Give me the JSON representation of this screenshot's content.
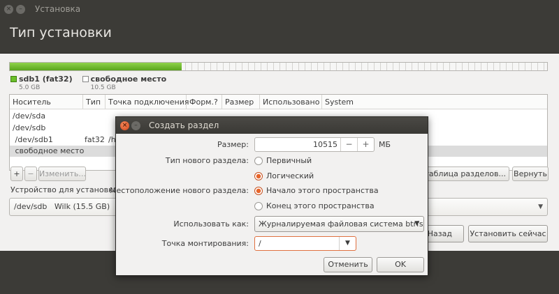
{
  "window": {
    "title": "Установка",
    "close_glyph": "×",
    "min_glyph": "–"
  },
  "heading": "Тип установки",
  "usage": {
    "fill_fraction": 0.32,
    "fill_color": "#6cbf2a"
  },
  "legend": [
    {
      "name": "sdb1 (fat32)",
      "size": "5.0 GB",
      "color": "#6cbf2a"
    },
    {
      "name": "свободное место",
      "size": "10.5 GB",
      "color": "#ffffff"
    }
  ],
  "table": {
    "columns": [
      "Носитель",
      "Тип",
      "Точка подключения",
      "Форм.?",
      "Размер",
      "Использовано",
      "System"
    ],
    "rows": [
      {
        "device": "/dev/sda",
        "type": "",
        "mount": ""
      },
      {
        "device": "/dev/sdb",
        "type": "",
        "mount": ""
      },
      {
        "device": " /dev/sdb1",
        "type": "fat32",
        "mount": "/h"
      },
      {
        "device": " свободное место",
        "type": "",
        "mount": ""
      }
    ]
  },
  "toolbar": {
    "add": "+",
    "remove": "−",
    "change": "Изменить...",
    "new_table": "таблица разделов...",
    "revert": "Вернуть"
  },
  "boot": {
    "label": "Устройство для установки с",
    "value": "/dev/sdb   Wilk (15.5 GB)",
    "arrow": "▼"
  },
  "footer": {
    "back": "Назад",
    "install": "Установить сейчас"
  },
  "dialog": {
    "title": "Создать раздел",
    "size_label": "Размер:",
    "size_value": "10515",
    "minus": "−",
    "plus": "+",
    "unit": "МБ",
    "type_label": "Тип нового раздела:",
    "type_options": [
      "Первичный",
      "Логический"
    ],
    "type_selected": "Логический",
    "location_label": "Местоположение нового раздела:",
    "location_options": [
      "Начало этого пространства",
      "Конец этого пространства"
    ],
    "location_selected": "Начало этого пространства",
    "use_as_label": "Использовать как:",
    "use_as_value": "Журналируемая файловая система btrfs",
    "mount_label": "Точка монтирования:",
    "mount_value": "/",
    "arrow": "▼",
    "cancel": "Отменить",
    "ok": "OK"
  }
}
